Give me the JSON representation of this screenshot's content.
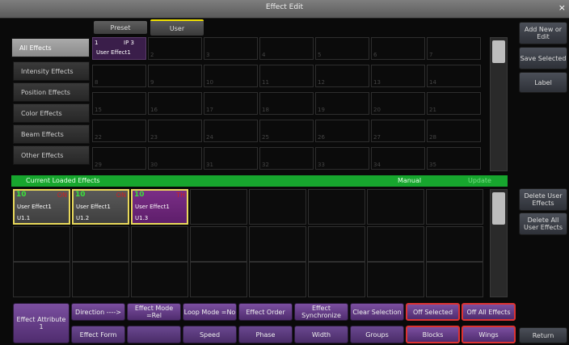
{
  "window": {
    "title": "Effect Edit",
    "close_glyph": "×"
  },
  "tabs": {
    "preset": "Preset",
    "user": "User"
  },
  "categories": [
    "All Effects",
    "Intensity Effects",
    "Position Effects",
    "Color Effects",
    "Beam Effects",
    "Other Effects"
  ],
  "grid_numbers": [
    "1",
    "2",
    "3",
    "4",
    "5",
    "6",
    "7",
    "8",
    "9",
    "10",
    "11",
    "12",
    "13",
    "14",
    "15",
    "16",
    "17",
    "18",
    "19",
    "20",
    "21",
    "22",
    "23",
    "24",
    "25",
    "26",
    "27",
    "28",
    "29",
    "30",
    "31",
    "32",
    "33",
    "34",
    "35"
  ],
  "grid_first": {
    "number": "1",
    "ip": "IP 3",
    "name": "User Effect1"
  },
  "loaded_bar": {
    "title": "Current Loaded Effects",
    "mode": "Manual",
    "update": "Update"
  },
  "loaded": [
    {
      "num": "10",
      "state": "ON",
      "name": "User Effect1",
      "id": "U1.1"
    },
    {
      "num": "10",
      "state": "ON",
      "name": "User Effect1",
      "id": "U1.2"
    },
    {
      "num": "10",
      "state": "TH",
      "name": "User Effect1",
      "id": "U1.3"
    }
  ],
  "right_buttons": {
    "add_new": "Add New or Edit",
    "save": "Save Selected",
    "label": "Label",
    "delete_user": "Delete User Effects",
    "delete_all": "Delete All User Effects",
    "return": "Return"
  },
  "bottom": {
    "attribute": "Effect Attribute 1",
    "row1": [
      "Direction ---->",
      "Effect Mode =Rel",
      "Loop Mode =No",
      "Effect Order",
      "Effect Synchronize",
      "Clear Selection",
      "Off Selected",
      "Off All Effects"
    ],
    "row2": [
      "Effect Form",
      "",
      "Speed",
      "Phase",
      "Width",
      "Groups",
      "Blocks",
      "Wings"
    ]
  }
}
